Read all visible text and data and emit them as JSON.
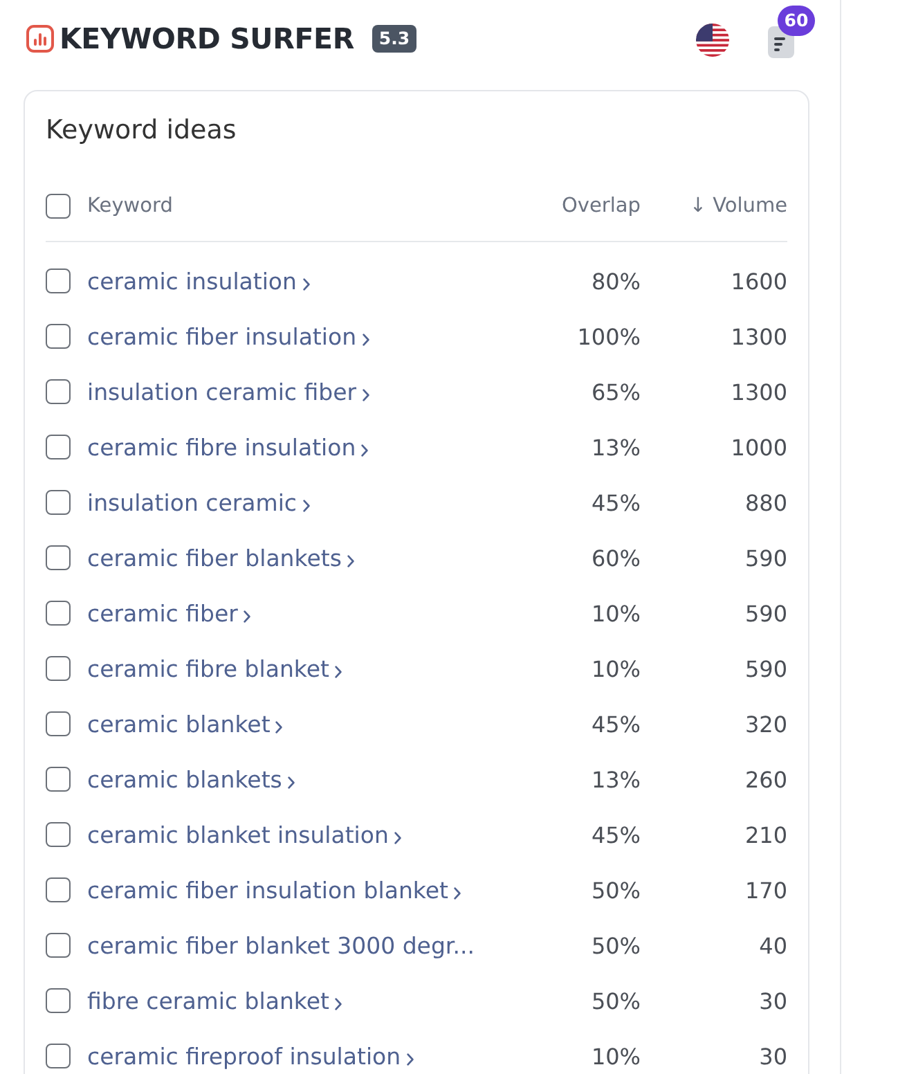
{
  "header": {
    "title": "KEYWORD SURFER",
    "version": "5.3",
    "notifications": "60"
  },
  "panel": {
    "title": "Keyword ideas",
    "select_all": {
      "checked": false
    },
    "columns": [
      "Keyword",
      "Overlap",
      "↓ Volume"
    ],
    "rows": [
      {
        "keyword": "ceramic insulation",
        "chevron": true,
        "checked": false,
        "overlap": "80%",
        "volume": "1600"
      },
      {
        "keyword": "ceramic fiber insulation",
        "chevron": true,
        "checked": false,
        "overlap": "100%",
        "volume": "1300"
      },
      {
        "keyword": "insulation ceramic fiber",
        "chevron": true,
        "checked": false,
        "overlap": "65%",
        "volume": "1300"
      },
      {
        "keyword": "ceramic fibre insulation",
        "chevron": true,
        "checked": false,
        "overlap": "13%",
        "volume": "1000"
      },
      {
        "keyword": "insulation ceramic",
        "chevron": true,
        "checked": false,
        "overlap": "45%",
        "volume": "880"
      },
      {
        "keyword": "ceramic fiber blankets",
        "chevron": true,
        "checked": false,
        "overlap": "60%",
        "volume": "590"
      },
      {
        "keyword": "ceramic fiber",
        "chevron": true,
        "checked": false,
        "overlap": "10%",
        "volume": "590"
      },
      {
        "keyword": "ceramic fibre blanket",
        "chevron": true,
        "checked": false,
        "overlap": "10%",
        "volume": "590"
      },
      {
        "keyword": "ceramic blanket",
        "chevron": true,
        "checked": false,
        "overlap": "45%",
        "volume": "320"
      },
      {
        "keyword": "ceramic blankets",
        "chevron": true,
        "checked": false,
        "overlap": "13%",
        "volume": "260"
      },
      {
        "keyword": "ceramic blanket insulation",
        "chevron": true,
        "checked": false,
        "overlap": "45%",
        "volume": "210"
      },
      {
        "keyword": "ceramic fiber insulation blanket",
        "chevron": true,
        "checked": false,
        "overlap": "50%",
        "volume": "170"
      },
      {
        "keyword": "ceramic fiber blanket 3000 degr...",
        "chevron": false,
        "checked": false,
        "overlap": "50%",
        "volume": "40"
      },
      {
        "keyword": "fibre ceramic blanket",
        "chevron": true,
        "checked": false,
        "overlap": "50%",
        "volume": "30"
      },
      {
        "keyword": "ceramic fireproof insulation",
        "chevron": true,
        "checked": false,
        "overlap": "10%",
        "volume": "30"
      }
    ]
  }
}
